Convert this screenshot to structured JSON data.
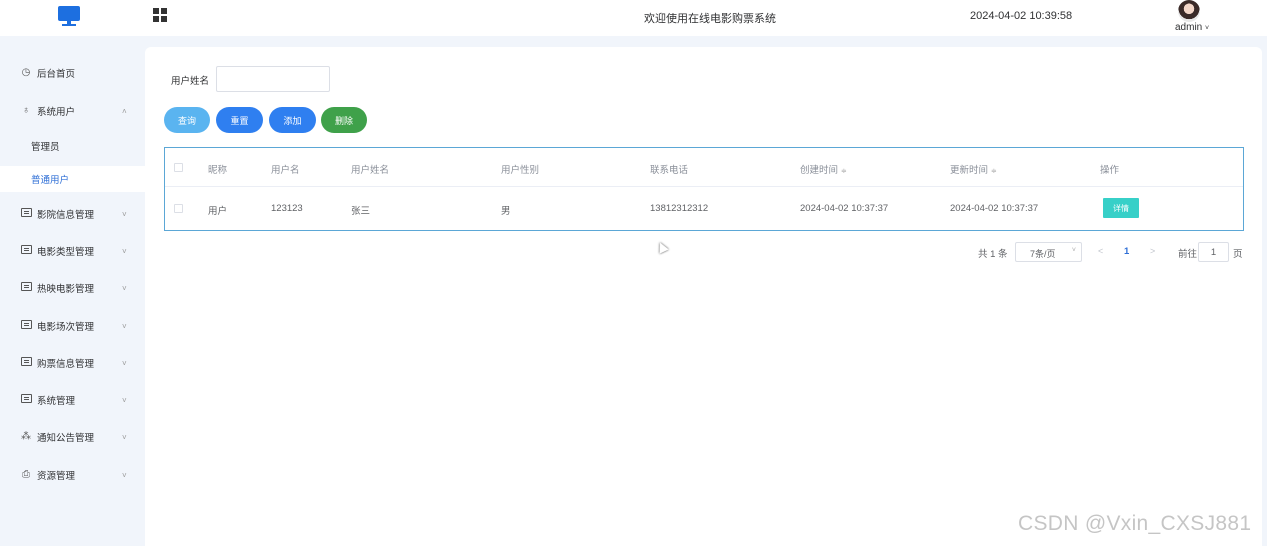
{
  "header": {
    "system_title": "欢迎使用在线电影购票系统",
    "datetime": "2024-04-02 10:39:58",
    "username": "admin",
    "user_caret": "˅"
  },
  "sidebar": {
    "items": [
      {
        "label": "后台首页",
        "icon": "clock-icon",
        "arrow": ""
      },
      {
        "label": "系统用户",
        "icon": "user-icon",
        "arrow": "˄"
      },
      {
        "label": "影院信息管理",
        "icon": "box-icon",
        "arrow": "˅"
      },
      {
        "label": "电影类型管理",
        "icon": "box-icon",
        "arrow": "˅"
      },
      {
        "label": "热映电影管理",
        "icon": "box-icon",
        "arrow": "˅"
      },
      {
        "label": "电影场次管理",
        "icon": "box-icon",
        "arrow": "˅"
      },
      {
        "label": "购票信息管理",
        "icon": "box-icon",
        "arrow": "˅"
      },
      {
        "label": "系统管理",
        "icon": "folder-icon",
        "arrow": "˅"
      },
      {
        "label": "通知公告管理",
        "icon": "loading-icon",
        "arrow": "˅"
      },
      {
        "label": "资源管理",
        "icon": "printer-icon",
        "arrow": "˅"
      }
    ],
    "sub_items": [
      {
        "label": "管理员",
        "active": false
      },
      {
        "label": "普通用户",
        "active": true
      }
    ]
  },
  "search": {
    "label": "用户姓名",
    "value": "",
    "placeholder": ""
  },
  "buttons": {
    "query": "查询",
    "reset": "重置",
    "add": "添加",
    "delete": "删除"
  },
  "table": {
    "columns": [
      "昵称",
      "用户名",
      "用户姓名",
      "用户性别",
      "联系电话",
      "创建时间",
      "更新时间",
      "操作"
    ],
    "sortable_mark": "≑",
    "rows": [
      {
        "nickname": "用户",
        "username": "123123",
        "realname": "张三",
        "gender": "男",
        "phone": "13812312312",
        "created": "2024-04-02 10:37:37",
        "updated": "2024-04-02 10:37:37",
        "action": "详情"
      }
    ]
  },
  "pagination": {
    "total_text": "共 1 条",
    "page_size": "7条/页",
    "page_size_caret": "˅",
    "prev": "<",
    "current_page": "1",
    "next": ">",
    "goto_label": "前往",
    "goto_value": "1",
    "page_suffix": "页"
  },
  "watermark": "CSDN @Vxin_CXSJ881",
  "colors": {
    "accent": "#2f6fd6",
    "btn_query": "#5ab4f0",
    "btn_primary": "#2f7ff0",
    "btn_delete": "#3fa14a",
    "btn_detail": "#37d0c8"
  }
}
